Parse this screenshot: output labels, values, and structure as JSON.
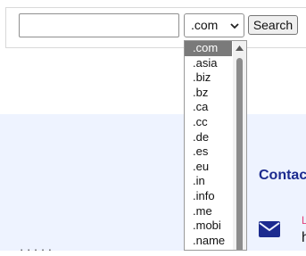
{
  "search": {
    "domain_value": "",
    "selected_tld": ".com",
    "button_label": "Search"
  },
  "tld_options": [
    ".com",
    ".asia",
    ".biz",
    ".bz",
    ".ca",
    ".cc",
    ".de",
    ".es",
    ".eu",
    ".in",
    ".info",
    ".me",
    ".mobi",
    ".name"
  ],
  "contact": {
    "heading": "Contac",
    "label_fragment": "L",
    "text_fragment": "h"
  },
  "colors": {
    "section_bg": "#eef3ff",
    "heading": "#1c2b8f",
    "accent_pink": "#e0407a",
    "icon": "#1c2b8f"
  }
}
